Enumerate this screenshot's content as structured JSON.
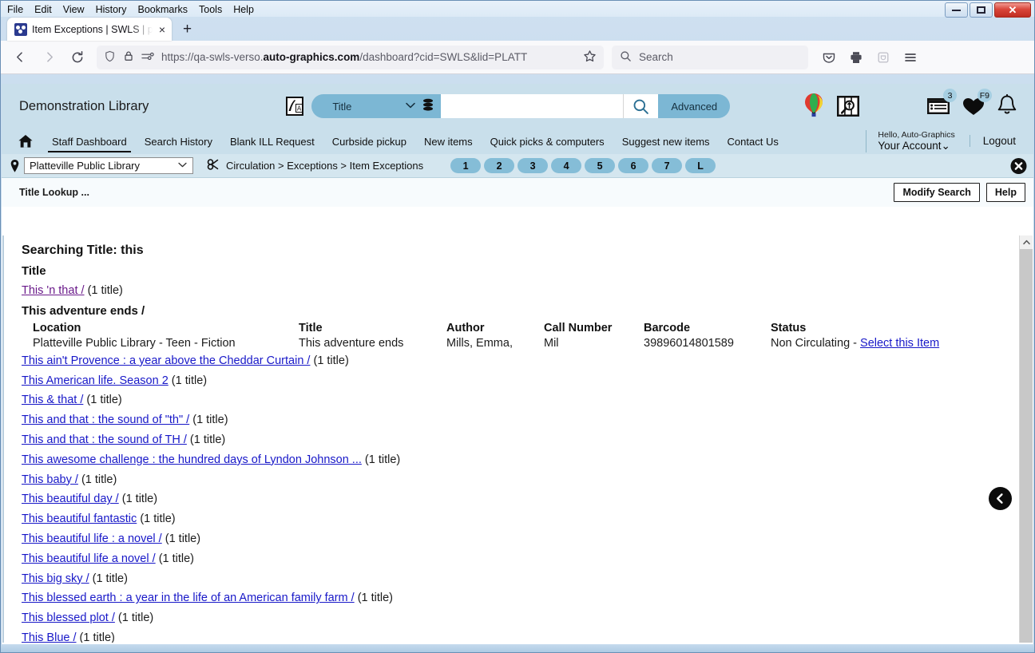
{
  "browser": {
    "menus": [
      "File",
      "Edit",
      "View",
      "History",
      "Bookmarks",
      "Tools",
      "Help"
    ],
    "tab_title": "Item Exceptions | SWLS | platt | A",
    "new_tab_label": "+",
    "close_tab_label": "×",
    "url_prefix": "https://qa-swls-verso.",
    "url_domain": "auto-graphics.com",
    "url_suffix": "/dashboard?cid=SWLS&lid=PLATT",
    "search_placeholder": "Search",
    "window_controls": {
      "minimize": "–",
      "maximize": "□",
      "close": "✕"
    }
  },
  "header": {
    "library_name": "Demonstration Library",
    "search_scope": "Title",
    "search_value": "",
    "advanced_label": "Advanced",
    "icons": [
      {
        "name": "balloon-icon"
      },
      {
        "name": "book-search-icon"
      },
      {
        "name": "lists-icon",
        "badge": "3"
      },
      {
        "name": "favorites-heart-icon",
        "badge": "F9"
      },
      {
        "name": "notifications-bell-icon",
        "badge": ""
      }
    ]
  },
  "nav": {
    "links": [
      "Staff Dashboard",
      "Search History",
      "Blank ILL Request",
      "Curbside pickup",
      "New items",
      "Quick picks & computers",
      "Suggest new items",
      "Contact Us"
    ],
    "active_index": 0,
    "hello": "Hello, Auto-Graphics",
    "your_account": "Your Account",
    "your_account_chevron": "⌄",
    "logout": "Logout"
  },
  "crumbbar": {
    "library_select": "Platteville Public Library",
    "select_chevron": "⌄",
    "breadcrumb": "Circulation > Exceptions > Item Exceptions",
    "page_buttons": [
      "1",
      "2",
      "3",
      "4",
      "5",
      "6",
      "7",
      "L"
    ],
    "close_label": "✕"
  },
  "toolbar": {
    "lookup_label": "Title Lookup ...",
    "modify_search_label": "Modify Search",
    "help_label": "Help"
  },
  "results": {
    "searching_label": "Searching Title: this",
    "column_title": "Title",
    "count_suffix": "(1 title)",
    "first_entry": {
      "label": "This 'n that /",
      "count": "(1 title)",
      "visited": true
    },
    "group_heading": "This adventure ends /",
    "item_table": {
      "headers": [
        "Location",
        "Title",
        "Author",
        "Call Number",
        "Barcode",
        "Status"
      ],
      "row": {
        "location": "Platteville Public Library - Teen - Fiction",
        "title": "This adventure ends",
        "author": "Mills, Emma,",
        "call_number": "Mil",
        "barcode": "39896014801589",
        "status": "Non Circulating -",
        "select_link": "Select this Item"
      }
    },
    "titles": [
      {
        "label": "This ain't Provence : a year above the Cheddar Curtain /",
        "count": "(1 title)"
      },
      {
        "label": "This American life. Season 2",
        "count": "(1 title)"
      },
      {
        "label": "This & that /",
        "count": "(1 title)"
      },
      {
        "label": "This and that : the sound of \"th\" /",
        "count": "(1 title)"
      },
      {
        "label": "This and that : the sound of TH /",
        "count": "(1 title)"
      },
      {
        "label": "This awesome challenge : the hundred days of Lyndon Johnson ...",
        "count": "(1 title)"
      },
      {
        "label": "This baby /",
        "count": "(1 title)"
      },
      {
        "label": "This beautiful day /",
        "count": "(1 title)"
      },
      {
        "label": "This beautiful fantastic",
        "count": "(1 title)"
      },
      {
        "label": "This beautiful life : a novel /",
        "count": "(1 title)"
      },
      {
        "label": "This beautiful life a novel /",
        "count": "(1 title)"
      },
      {
        "label": "This big sky /",
        "count": "(1 title)"
      },
      {
        "label": "This blessed earth : a year in the life of an American family farm /",
        "count": "(1 title)"
      },
      {
        "label": "This blessed plot /",
        "count": "(1 title)"
      },
      {
        "label": "This Blue /",
        "count": "(1 title)"
      }
    ]
  },
  "colors": {
    "header_bg": "#c9dfeb",
    "accent": "#7cb7d4",
    "link": "#1818c8",
    "visited_link": "#6a1a8a",
    "page_pill": "#85bdd7"
  }
}
